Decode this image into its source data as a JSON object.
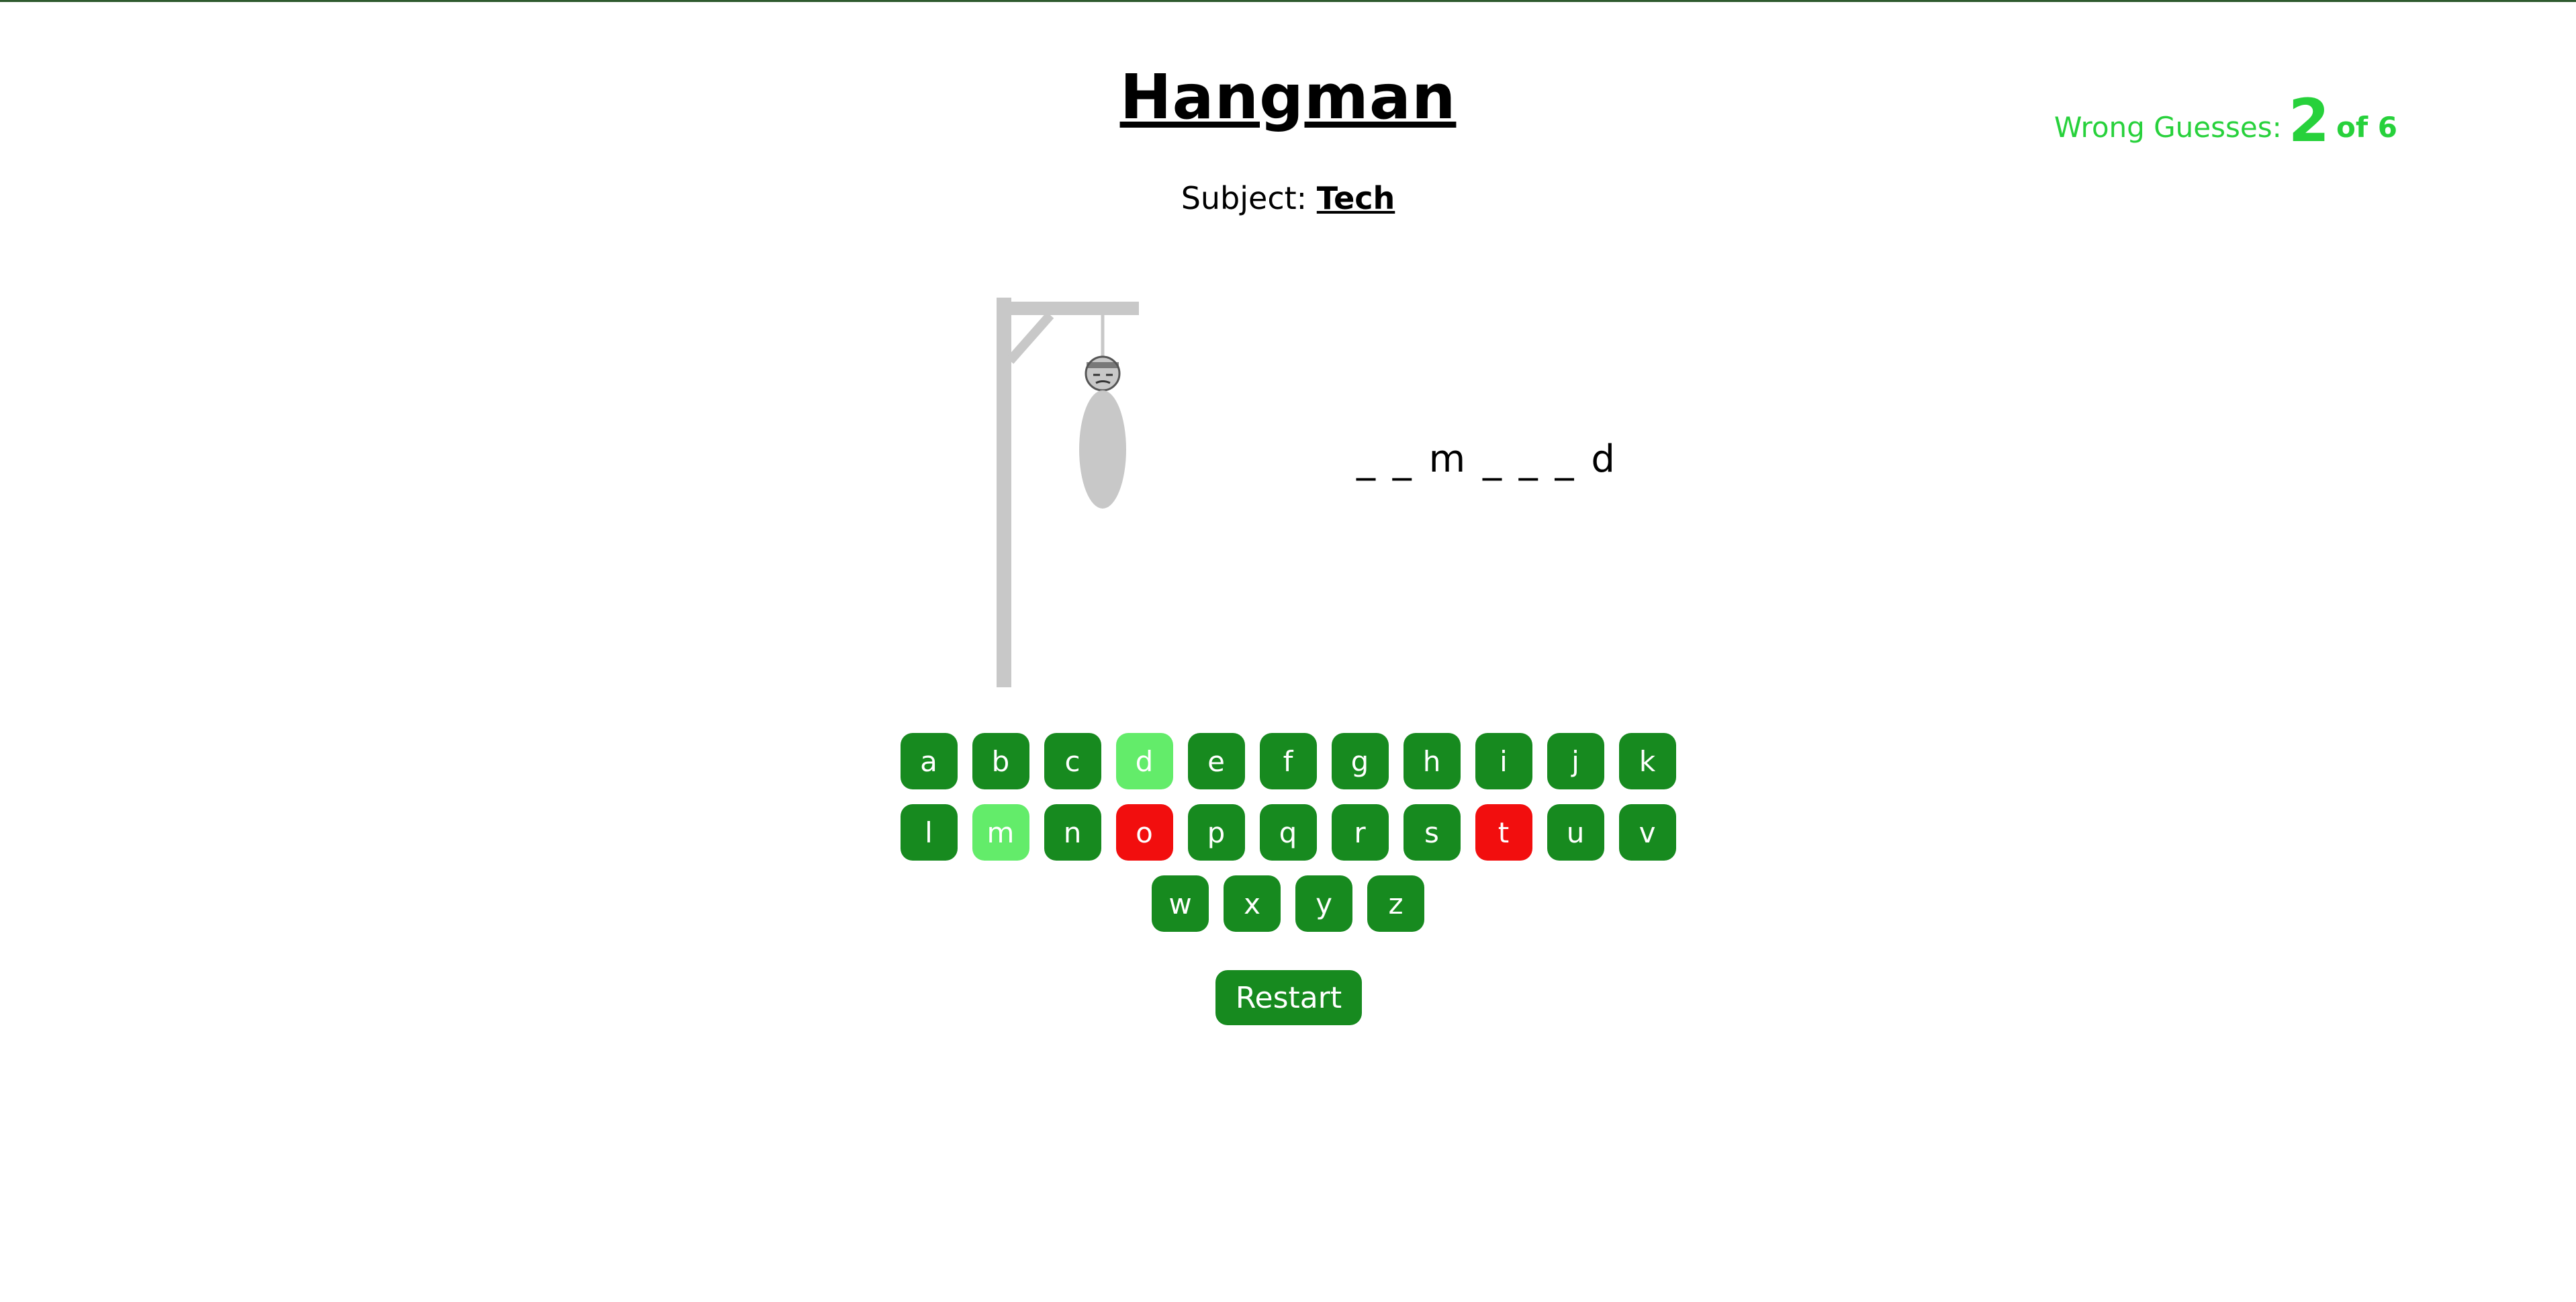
{
  "title": "Hangman",
  "subject": {
    "label": "Subject:",
    "value": "Tech"
  },
  "wrong_guesses": {
    "label": "Wrong Guesses:",
    "count": "2",
    "of_label": "of 6"
  },
  "word_display": "_ _ m _ _ _ d",
  "keyboard": {
    "row1": [
      "a",
      "b",
      "c",
      "d",
      "e",
      "f",
      "g",
      "h",
      "i",
      "j",
      "k"
    ],
    "row2": [
      "l",
      "m",
      "n",
      "o",
      "p",
      "q",
      "r",
      "s",
      "t",
      "u",
      "v"
    ],
    "row3": [
      "w",
      "x",
      "y",
      "z"
    ],
    "correct_letters": [
      "d",
      "m"
    ],
    "wrong_letters": [
      "o",
      "t"
    ]
  },
  "restart_label": "Restart",
  "colors": {
    "key": "#178a1f",
    "key_correct": "#63ec6a",
    "key_wrong": "#f20e0e",
    "counter": "#27d13b",
    "gallows": "#c8c8c8"
  }
}
